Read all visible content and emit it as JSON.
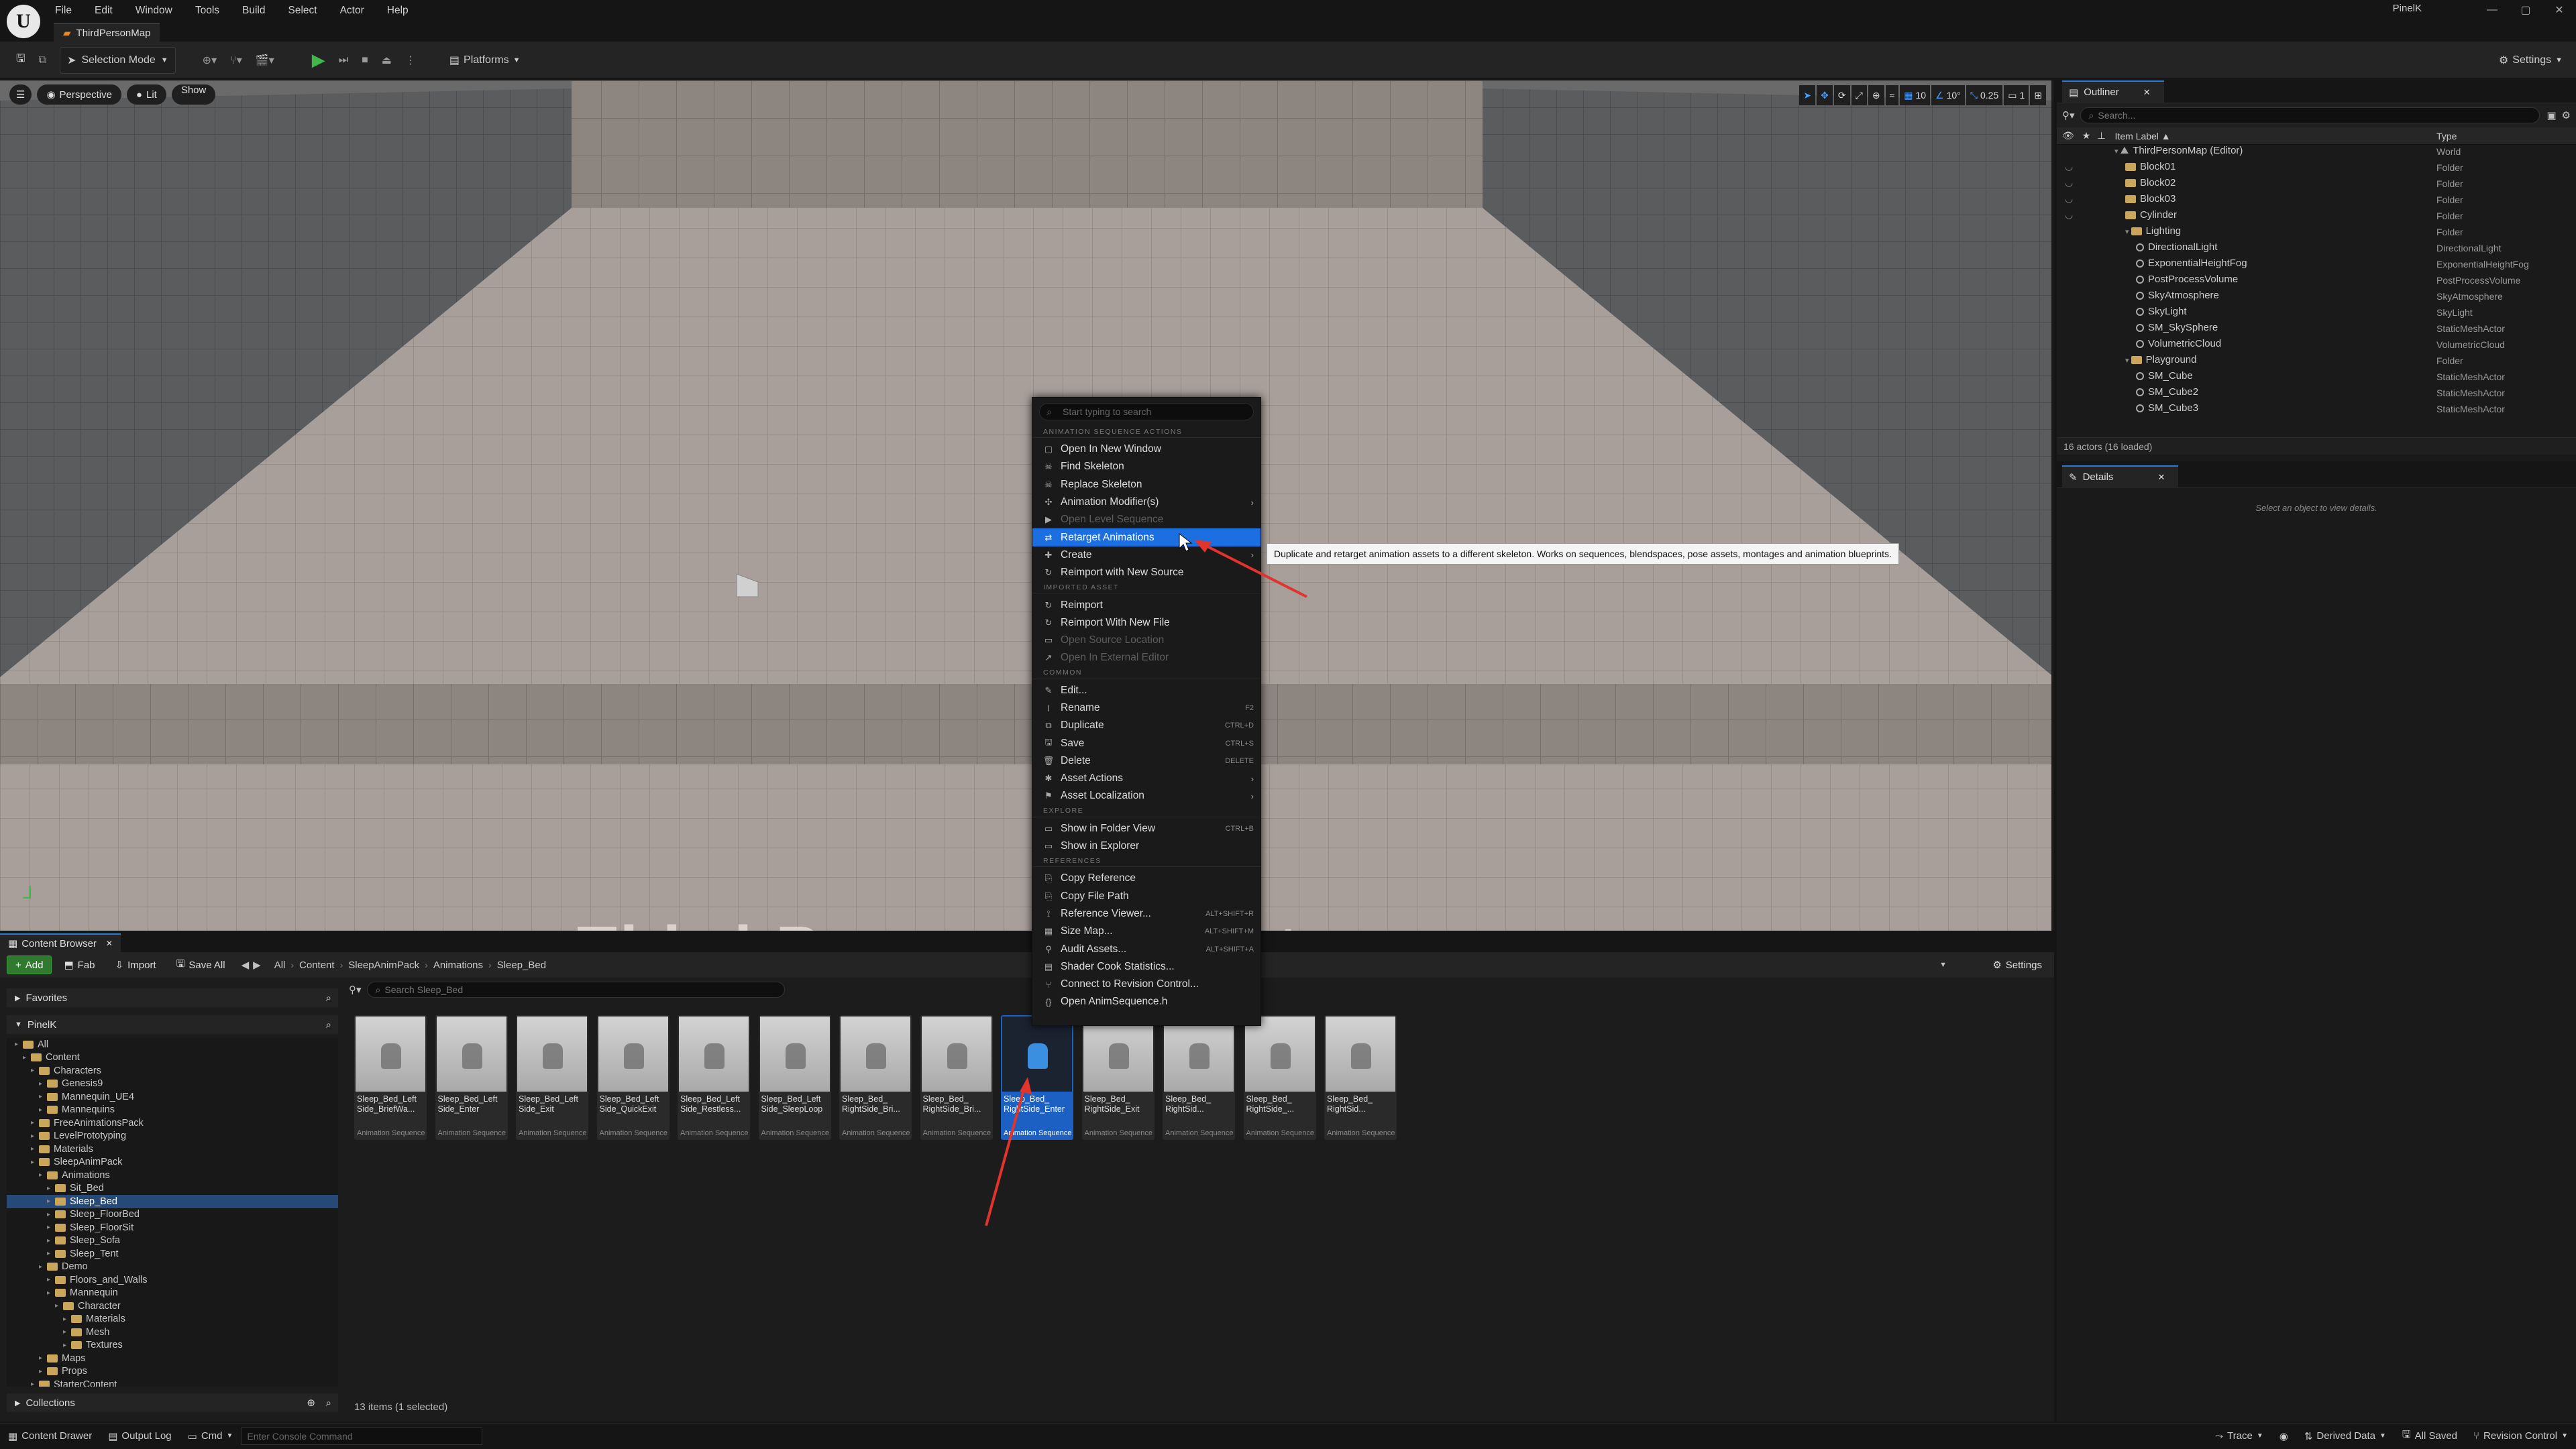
{
  "app": {
    "menus": [
      "File",
      "Edit",
      "Window",
      "Tools",
      "Build",
      "Select",
      "Actor",
      "Help"
    ],
    "map_tab": "ThirdPersonMap",
    "user": "PinelK",
    "win_controls": [
      "—",
      "▢",
      "✕"
    ]
  },
  "toolbar": {
    "selection_mode": "Selection Mode",
    "platforms": "Platforms",
    "settings": "Settings"
  },
  "viewport": {
    "perspective": "Perspective",
    "lit": "Lit",
    "show": "Show",
    "grid_snap": "10",
    "rot_snap": "10°",
    "scale_snap": "0.25",
    "camera_speed": "1",
    "floor_text": "Third Person Template"
  },
  "outliner": {
    "title": "Outliner",
    "search_placeholder": "Search...",
    "col_label": "Item Label ▲",
    "col_type": "Type",
    "rows": [
      {
        "label": "ThirdPersonMap (Editor)",
        "type": "World",
        "indent": 0,
        "kind": "world"
      },
      {
        "label": "Block01",
        "type": "Folder",
        "indent": 1,
        "kind": "folder"
      },
      {
        "label": "Block02",
        "type": "Folder",
        "indent": 1,
        "kind": "folder"
      },
      {
        "label": "Block03",
        "type": "Folder",
        "indent": 1,
        "kind": "folder"
      },
      {
        "label": "Cylinder",
        "type": "Folder",
        "indent": 1,
        "kind": "folder"
      },
      {
        "label": "Lighting",
        "type": "Folder",
        "indent": 1,
        "kind": "folder"
      },
      {
        "label": "DirectionalLight",
        "type": "DirectionalLight",
        "indent": 2,
        "kind": "actor"
      },
      {
        "label": "ExponentialHeightFog",
        "type": "ExponentialHeightFog",
        "indent": 2,
        "kind": "actor"
      },
      {
        "label": "PostProcessVolume",
        "type": "PostProcessVolume",
        "indent": 2,
        "kind": "actor"
      },
      {
        "label": "SkyAtmosphere",
        "type": "SkyAtmosphere",
        "indent": 2,
        "kind": "actor"
      },
      {
        "label": "SkyLight",
        "type": "SkyLight",
        "indent": 2,
        "kind": "actor"
      },
      {
        "label": "SM_SkySphere",
        "type": "StaticMeshActor",
        "indent": 2,
        "kind": "actor"
      },
      {
        "label": "VolumetricCloud",
        "type": "VolumetricCloud",
        "indent": 2,
        "kind": "actor"
      },
      {
        "label": "Playground",
        "type": "Folder",
        "indent": 1,
        "kind": "folder"
      },
      {
        "label": "SM_Cube",
        "type": "StaticMeshActor",
        "indent": 2,
        "kind": "actor"
      },
      {
        "label": "SM_Cube2",
        "type": "StaticMeshActor",
        "indent": 2,
        "kind": "actor"
      },
      {
        "label": "SM_Cube3",
        "type": "StaticMeshActor",
        "indent": 2,
        "kind": "actor"
      }
    ],
    "status": "16 actors (16 loaded)"
  },
  "details": {
    "title": "Details",
    "empty": "Select an object to view details."
  },
  "content_browser": {
    "tab": "Content Browser",
    "add": "Add",
    "fab": "Fab",
    "import": "Import",
    "save_all": "Save All",
    "settings": "Settings",
    "breadcrumb": [
      "All",
      "Content",
      "SleepAnimPack",
      "Animations",
      "Sleep_Bed"
    ],
    "search_placeholder": "Search Sleep_Bed",
    "favorites": "Favorites",
    "root": "PinelK",
    "collections": "Collections",
    "status": "13 items (1 selected)",
    "tree": [
      {
        "label": "All",
        "indent": 0
      },
      {
        "label": "Content",
        "indent": 1
      },
      {
        "label": "Characters",
        "indent": 2
      },
      {
        "label": "Genesis9",
        "indent": 3
      },
      {
        "label": "Mannequin_UE4",
        "indent": 3
      },
      {
        "label": "Mannequins",
        "indent": 3
      },
      {
        "label": "FreeAnimationsPack",
        "indent": 2
      },
      {
        "label": "LevelPrototyping",
        "indent": 2
      },
      {
        "label": "Materials",
        "indent": 2
      },
      {
        "label": "SleepAnimPack",
        "indent": 2
      },
      {
        "label": "Animations",
        "indent": 3
      },
      {
        "label": "Sit_Bed",
        "indent": 4
      },
      {
        "label": "Sleep_Bed",
        "indent": 4,
        "selected": true
      },
      {
        "label": "Sleep_FloorBed",
        "indent": 4
      },
      {
        "label": "Sleep_FloorSit",
        "indent": 4
      },
      {
        "label": "Sleep_Sofa",
        "indent": 4
      },
      {
        "label": "Sleep_Tent",
        "indent": 4
      },
      {
        "label": "Demo",
        "indent": 3
      },
      {
        "label": "Floors_and_Walls",
        "indent": 4
      },
      {
        "label": "Mannequin",
        "indent": 4
      },
      {
        "label": "Character",
        "indent": 5
      },
      {
        "label": "Materials",
        "indent": 6
      },
      {
        "label": "Mesh",
        "indent": 6
      },
      {
        "label": "Textures",
        "indent": 6
      },
      {
        "label": "Maps",
        "indent": 3
      },
      {
        "label": "Props",
        "indent": 3
      },
      {
        "label": "StarterContent",
        "indent": 2
      }
    ],
    "assets": [
      {
        "name": "Sleep_Bed_Left Side_BriefWa...",
        "type": "Animation Sequence"
      },
      {
        "name": "Sleep_Bed_Left Side_Enter",
        "type": "Animation Sequence"
      },
      {
        "name": "Sleep_Bed_Left Side_Exit",
        "type": "Animation Sequence"
      },
      {
        "name": "Sleep_Bed_Left Side_QuickExit",
        "type": "Animation Sequence"
      },
      {
        "name": "Sleep_Bed_Left Side_Restless...",
        "type": "Animation Sequence"
      },
      {
        "name": "Sleep_Bed_Left Side_SleepLoop",
        "type": "Animation Sequence"
      },
      {
        "name": "Sleep_Bed_ RightSide_Bri...",
        "type": "Animation Sequence"
      },
      {
        "name": "Sleep_Bed_ RightSide_Bri...",
        "type": "Animation Sequence"
      },
      {
        "name": "Sleep_Bed_ RightSide_Enter",
        "type": "Animation Sequence",
        "selected": true
      },
      {
        "name": "Sleep_Bed_ RightSide_Exit",
        "type": "Animation Sequence"
      },
      {
        "name": "Sleep_Bed_ RightSid...",
        "type": "Animation Sequence"
      },
      {
        "name": "Sleep_Bed_ RightSide_...",
        "type": "Animation Sequence"
      },
      {
        "name": "Sleep_Bed_ RightSid...",
        "type": "Animation Sequence"
      }
    ]
  },
  "context_menu": {
    "search_placeholder": "Start typing to search",
    "sections": [
      {
        "header": "Animation Sequence Actions",
        "items": [
          {
            "label": "Open In New Window",
            "icon": "window-icon"
          },
          {
            "label": "Find Skeleton",
            "icon": "skeleton-icon"
          },
          {
            "label": "Replace Skeleton",
            "icon": "skeleton-icon"
          },
          {
            "label": "Animation Modifier(s)",
            "icon": "modifier-icon",
            "submenu": true
          },
          {
            "label": "Open Level Sequence",
            "icon": "sequence-icon",
            "disabled": true
          },
          {
            "label": "Retarget Animations",
            "icon": "retarget-icon",
            "highlight": true
          },
          {
            "label": "Create",
            "icon": "create-icon",
            "submenu": true
          },
          {
            "label": "Reimport with New Source",
            "icon": "reimport-icon"
          }
        ]
      },
      {
        "header": "Imported Asset",
        "items": [
          {
            "label": "Reimport",
            "icon": "reimport-icon"
          },
          {
            "label": "Reimport With New File",
            "icon": "reimport-icon"
          },
          {
            "label": "Open Source Location",
            "icon": "folder-icon",
            "disabled": true
          },
          {
            "label": "Open In External Editor",
            "icon": "external-icon",
            "disabled": true
          }
        ]
      },
      {
        "header": "Common",
        "items": [
          {
            "label": "Edit...",
            "icon": "edit-icon"
          },
          {
            "label": "Rename",
            "icon": "rename-icon",
            "shortcut": "F2"
          },
          {
            "label": "Duplicate",
            "icon": "duplicate-icon",
            "shortcut": "CTRL+D"
          },
          {
            "label": "Save",
            "icon": "save-icon",
            "shortcut": "CTRL+S"
          },
          {
            "label": "Delete",
            "icon": "delete-icon",
            "shortcut": "DELETE"
          },
          {
            "label": "Asset Actions",
            "icon": "actions-icon",
            "submenu": true
          },
          {
            "label": "Asset Localization",
            "icon": "localization-icon",
            "submenu": true
          }
        ]
      },
      {
        "header": "Explore",
        "items": [
          {
            "label": "Show in Folder View",
            "icon": "folder-icon",
            "shortcut": "CTRL+B"
          },
          {
            "label": "Show in Explorer",
            "icon": "folder-icon"
          }
        ]
      },
      {
        "header": "References",
        "items": [
          {
            "label": "Copy Reference",
            "icon": "copy-icon"
          },
          {
            "label": "Copy File Path",
            "icon": "copy-icon"
          },
          {
            "label": "Reference Viewer...",
            "icon": "reference-icon",
            "shortcut": "ALT+SHIFT+R"
          },
          {
            "label": "Size Map...",
            "icon": "sizemap-icon",
            "shortcut": "ALT+SHIFT+M"
          },
          {
            "label": "Audit Assets...",
            "icon": "audit-icon",
            "shortcut": "ALT+SHIFT+A"
          },
          {
            "label": "Shader Cook Statistics...",
            "icon": "stats-icon"
          },
          {
            "label": "Connect to Revision Control...",
            "icon": "revision-icon"
          },
          {
            "label": "Open AnimSequence.h",
            "icon": "code-icon"
          }
        ]
      }
    ],
    "tooltip": "Duplicate and retarget animation assets to a different skeleton. Works on sequences, blendspaces, pose assets, montages and animation blueprints."
  },
  "bottom_bar": {
    "content_drawer": "Content Drawer",
    "output_log": "Output Log",
    "cmd": "Cmd",
    "console_placeholder": "Enter Console Command",
    "trace": "Trace",
    "derived_data": "Derived Data",
    "all_saved": "All Saved",
    "revision_control": "Revision Control"
  },
  "colors": {
    "accent": "#1c6fe0",
    "annotation_arrow": "#e0342c",
    "play": "#41b54a"
  }
}
